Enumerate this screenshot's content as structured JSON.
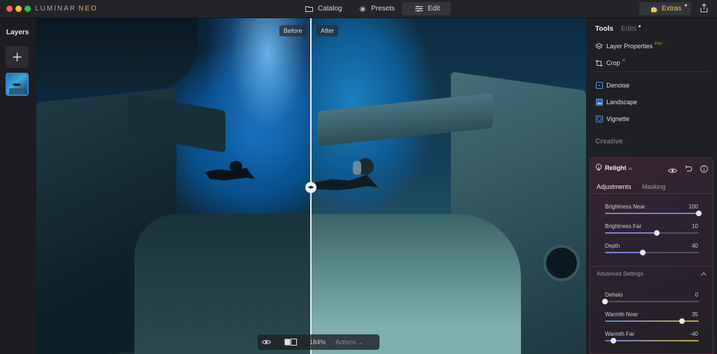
{
  "app": {
    "brand_main": "LUMINAR",
    "brand_accent": "NEO",
    "modes": [
      {
        "label": "Catalog",
        "active": false
      },
      {
        "label": "Presets",
        "active": false
      },
      {
        "label": "Edit",
        "active": true
      }
    ],
    "extras_label": "Extras"
  },
  "layers": {
    "title": "Layers"
  },
  "canvas": {
    "before_label": "Before",
    "after_label": "After",
    "zoom": "184%",
    "actions_label": "Actions"
  },
  "panel": {
    "tabs": {
      "tools": "Tools",
      "edits": "Edits"
    },
    "items": [
      {
        "label": "Layer Properties",
        "badge": "PRO",
        "icon": "layers-icon"
      },
      {
        "label": "Crop",
        "badge": "AI",
        "icon": "crop-icon"
      }
    ],
    "essentials": [
      {
        "label": "Denoise",
        "icon": "denoise-icon"
      },
      {
        "label": "Landscape",
        "icon": "landscape-icon"
      },
      {
        "label": "Vignette",
        "icon": "vignette-icon"
      }
    ],
    "section_creative": "Creative",
    "relight": {
      "title": "Relight",
      "badge": "AI",
      "subtabs": {
        "adjustments": "Adjustments",
        "masking": "Masking"
      },
      "sliders": [
        {
          "label": "Brightness Near",
          "value": "100",
          "position": 1.0
        },
        {
          "label": "Brightness Far",
          "value": "10",
          "position": 0.55
        },
        {
          "label": "Depth",
          "value": "40",
          "position": 0.4
        }
      ],
      "advanced_label": "Advanced Settings",
      "advanced_sliders": [
        {
          "label": "Dehalo",
          "value": "0",
          "position": 0.0
        },
        {
          "label": "Warmth Near",
          "value": "35",
          "position": 0.82
        },
        {
          "label": "Warmth Far",
          "value": "-40",
          "position": 0.09
        }
      ]
    }
  },
  "colors": {
    "accent_gold": "#d8b04a",
    "relight_bg": "#3a2430",
    "selection_blue": "#3c82d8",
    "slider_track_warm": "#c9a43a",
    "slider_track_cool": "#7a7fd8"
  }
}
